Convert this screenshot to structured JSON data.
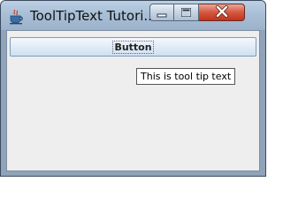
{
  "window": {
    "title": "ToolTipText Tutori...",
    "controls": {
      "minimize_icon": "minimize-icon",
      "maximize_icon": "maximize-icon",
      "close_icon": "close-icon"
    },
    "app_icon": "java-coffee-cup-icon"
  },
  "content": {
    "button_label": "Button",
    "tooltip_text": "This is tool tip text"
  },
  "colors": {
    "titlebar": "#a9bfd6",
    "close_button": "#d5573f",
    "panel_background": "#eeeeee",
    "button_border": "#7a9cbf"
  }
}
